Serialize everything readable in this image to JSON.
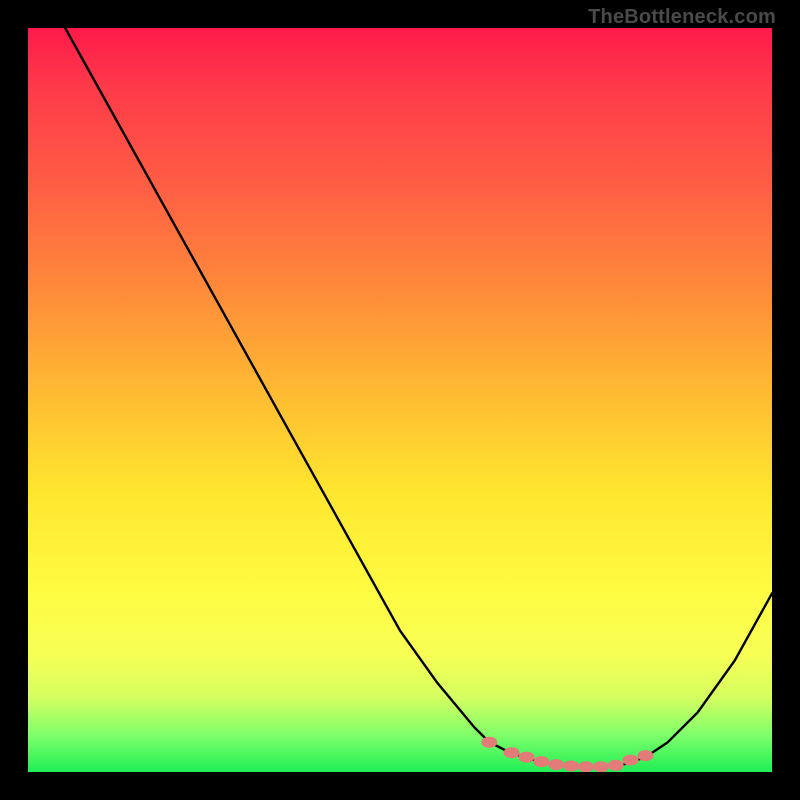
{
  "watermark": "TheBottleneck.com",
  "chart_data": {
    "type": "line",
    "title": "",
    "xlabel": "",
    "ylabel": "",
    "xlim": [
      0,
      100
    ],
    "ylim": [
      0,
      100
    ],
    "series": [
      {
        "name": "bottleneck-curve",
        "x": [
          5,
          10,
          15,
          20,
          25,
          30,
          35,
          40,
          45,
          50,
          55,
          60,
          62,
          65,
          68,
          71,
          74,
          77,
          80,
          83,
          86,
          90,
          95,
          100
        ],
        "values": [
          100,
          91,
          82,
          73,
          64,
          55,
          46,
          37,
          28,
          19,
          12,
          6,
          4,
          2.5,
          1.6,
          1.0,
          0.7,
          0.7,
          1.0,
          2.0,
          4.0,
          8.0,
          15.0,
          24.0
        ]
      }
    ],
    "markers": {
      "name": "highlight-dots",
      "color": "#e37b78",
      "x": [
        62,
        65,
        67,
        69,
        71,
        73,
        75,
        77,
        79,
        81,
        83
      ],
      "values": [
        4.0,
        2.6,
        2.0,
        1.4,
        1.0,
        0.8,
        0.7,
        0.7,
        0.9,
        1.6,
        2.2
      ]
    },
    "background_gradient": {
      "top": "#ff1a4a",
      "mid": "#ffe52e",
      "bottom": "#1fef55"
    }
  }
}
